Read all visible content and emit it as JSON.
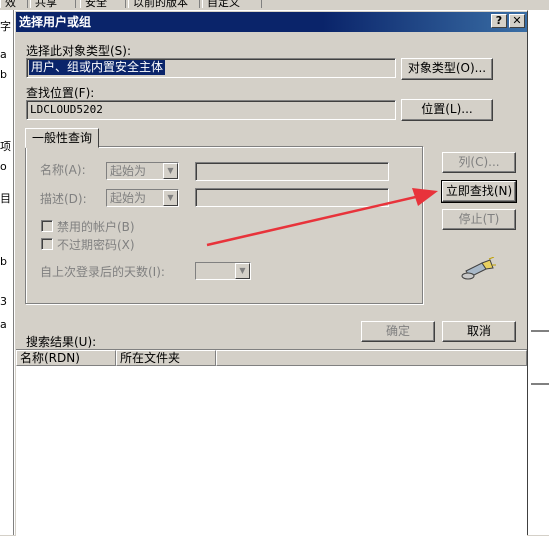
{
  "background_window": {
    "tabs": [
      "效",
      "共享",
      "安全",
      "以前的版本",
      "自定义"
    ],
    "left_chars": [
      "字",
      "a",
      "b",
      "项",
      "o",
      "目",
      "b",
      "3",
      "a"
    ]
  },
  "dialog": {
    "title": "选择用户或组",
    "help_btn": "?",
    "close_btn": "✕",
    "object_type_label": "选择此对象类型(S):",
    "object_type_value": "用户、组或内置安全主体",
    "object_type_button": "对象类型(O)...",
    "location_label": "查找位置(F):",
    "location_value": "LDCLOUD5202",
    "location_button": "位置(L)...",
    "tab_label": "一般性查询",
    "name_label": "名称(A):",
    "name_mode": "起始为",
    "desc_label": "描述(D):",
    "desc_mode": "起始为",
    "disabled_accounts": "禁用的帐户(B)",
    "non_expiring_pw": "不过期密码(X)",
    "days_since_login": "自上次登录后的天数(I):",
    "columns_button": "列(C)...",
    "find_now_button": "立即查找(N)",
    "stop_button": "停止(T)",
    "ok_button": "确定",
    "cancel_button": "取消",
    "results_label": "搜索结果(U):",
    "result_columns": [
      "名称(RDN)",
      "所在文件夹"
    ]
  },
  "colors": {
    "title_bar": "#0a246a",
    "dialog_face": "#d4d0c8",
    "annotation_arrow": "#e8333b"
  },
  "icons": [
    "search-flashlight-icon",
    "red-annotation-arrow"
  ]
}
